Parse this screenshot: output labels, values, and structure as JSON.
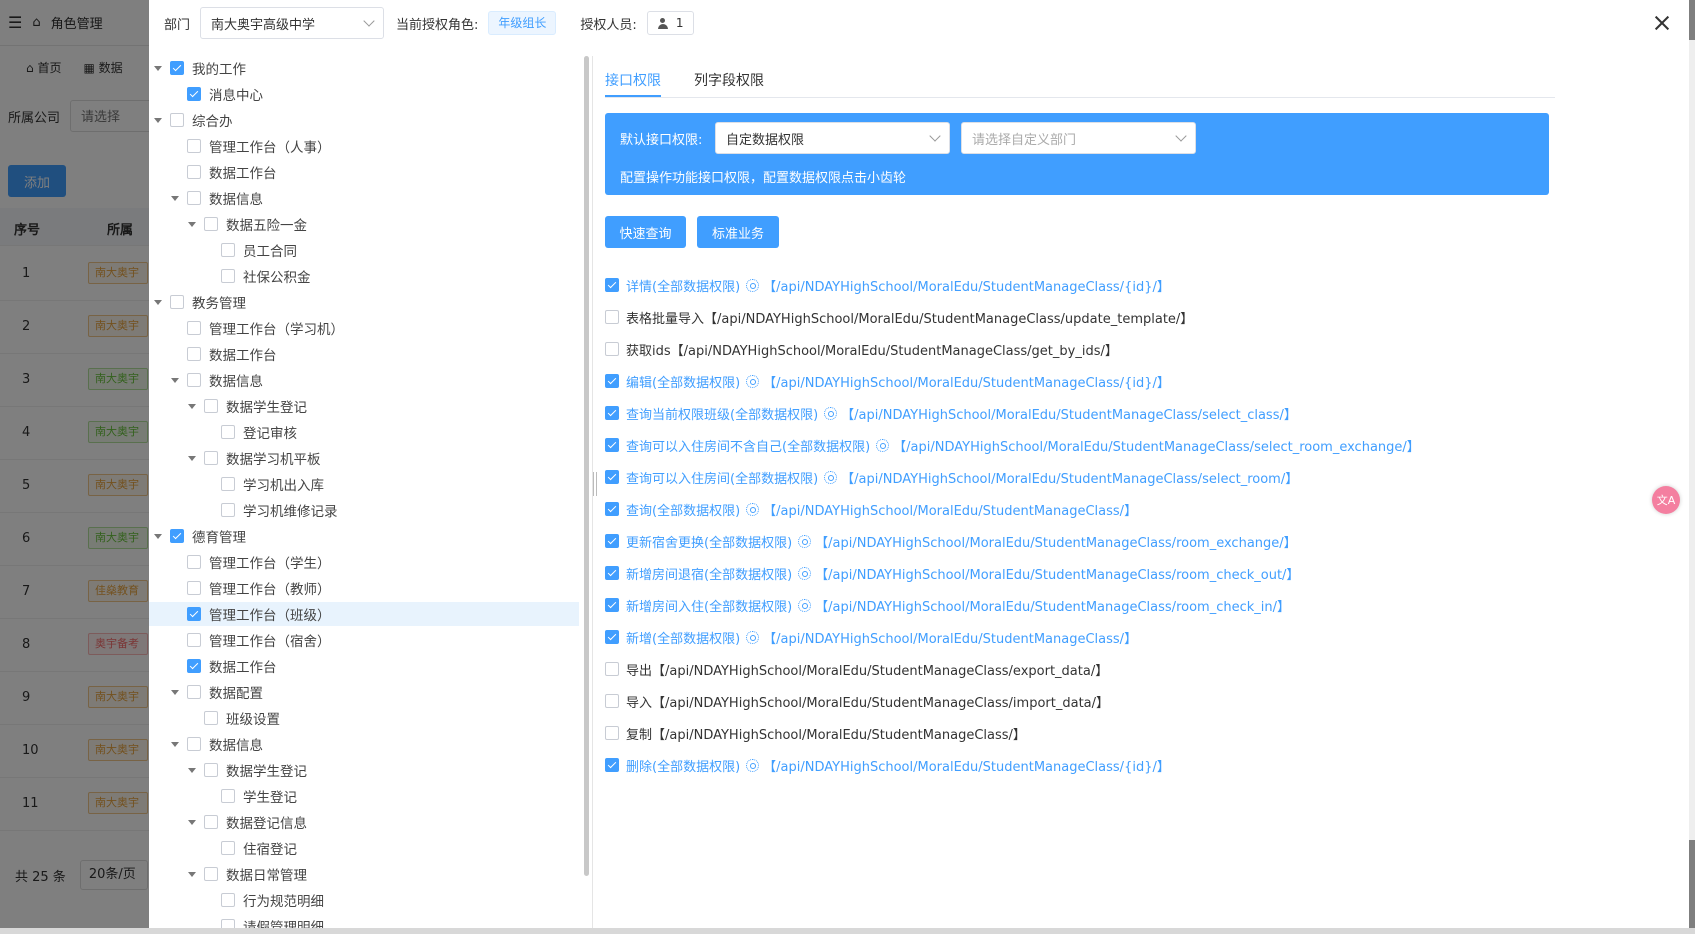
{
  "background": {
    "menu_icon": "menu-icon",
    "home_icon": "home-icon",
    "title": "角色管理",
    "tabs": [
      "首页",
      "数据"
    ],
    "company_label": "所属公司",
    "company_placeholder": "请选择",
    "add_label": "添加",
    "col_index": "序号",
    "col_company": "所属",
    "rows": [
      {
        "num": "1",
        "tag": "南大奥宇"
      },
      {
        "num": "2",
        "tag": "南大奥宇"
      },
      {
        "num": "3",
        "tag": "南大奥宇"
      },
      {
        "num": "4",
        "tag": "南大奥宇"
      },
      {
        "num": "5",
        "tag": "南大奥宇"
      },
      {
        "num": "6",
        "tag": "南大奥宇"
      },
      {
        "num": "7",
        "tag": "佳燊教育"
      },
      {
        "num": "8",
        "tag": "奥宇备考"
      },
      {
        "num": "9",
        "tag": "南大奥宇"
      },
      {
        "num": "10",
        "tag": "南大奥宇"
      },
      {
        "num": "11",
        "tag": "南大奥宇"
      }
    ],
    "total": "共 25 条",
    "page_size": "20条/页"
  },
  "header": {
    "dept_label": "部门",
    "dept_value": "南大奥宇高级中学",
    "role_label": "当前授权角色:",
    "role_value": "年级组长",
    "person_label": "授权人员:",
    "person_count": "1"
  },
  "tree": [
    {
      "label": "我的工作",
      "level": 0,
      "caret": true,
      "checked": true
    },
    {
      "label": "消息中心",
      "level": 1,
      "caret": false,
      "checked": true
    },
    {
      "label": "综合办",
      "level": 0,
      "caret": true,
      "checked": false
    },
    {
      "label": "管理工作台（人事）",
      "level": 1,
      "caret": false,
      "checked": false
    },
    {
      "label": "数据工作台",
      "level": 1,
      "caret": false,
      "checked": false
    },
    {
      "label": "数据信息",
      "level": 1,
      "caret": true,
      "checked": false
    },
    {
      "label": "数据五险一金",
      "level": 2,
      "caret": true,
      "checked": false
    },
    {
      "label": "员工合同",
      "level": 3,
      "caret": false,
      "checked": false
    },
    {
      "label": "社保公积金",
      "level": 3,
      "caret": false,
      "checked": false
    },
    {
      "label": "教务管理",
      "level": 0,
      "caret": true,
      "checked": false
    },
    {
      "label": "管理工作台（学习机）",
      "level": 1,
      "caret": false,
      "checked": false
    },
    {
      "label": "数据工作台",
      "level": 1,
      "caret": false,
      "checked": false
    },
    {
      "label": "数据信息",
      "level": 1,
      "caret": true,
      "checked": false
    },
    {
      "label": "数据学生登记",
      "level": 2,
      "caret": true,
      "checked": false
    },
    {
      "label": "登记审核",
      "level": 3,
      "caret": false,
      "checked": false
    },
    {
      "label": "数据学习机平板",
      "level": 2,
      "caret": true,
      "checked": false
    },
    {
      "label": "学习机出入库",
      "level": 3,
      "caret": false,
      "checked": false
    },
    {
      "label": "学习机维修记录",
      "level": 3,
      "caret": false,
      "checked": false
    },
    {
      "label": "德育管理",
      "level": 0,
      "caret": true,
      "checked": true
    },
    {
      "label": "管理工作台（学生）",
      "level": 1,
      "caret": false,
      "checked": false
    },
    {
      "label": "管理工作台（教师）",
      "level": 1,
      "caret": false,
      "checked": false
    },
    {
      "label": "管理工作台（班级）",
      "level": 1,
      "caret": false,
      "checked": true,
      "highlight": true
    },
    {
      "label": "管理工作台（宿舍）",
      "level": 1,
      "caret": false,
      "checked": false
    },
    {
      "label": "数据工作台",
      "level": 1,
      "caret": false,
      "checked": true
    },
    {
      "label": "数据配置",
      "level": 1,
      "caret": true,
      "checked": false
    },
    {
      "label": "班级设置",
      "level": 2,
      "caret": false,
      "checked": false
    },
    {
      "label": "数据信息",
      "level": 1,
      "caret": true,
      "checked": false
    },
    {
      "label": "数据学生登记",
      "level": 2,
      "caret": true,
      "checked": false
    },
    {
      "label": "学生登记",
      "level": 3,
      "caret": false,
      "checked": false
    },
    {
      "label": "数据登记信息",
      "level": 2,
      "caret": true,
      "checked": false
    },
    {
      "label": "住宿登记",
      "level": 3,
      "caret": false,
      "checked": false
    },
    {
      "label": "数据日常管理",
      "level": 2,
      "caret": true,
      "checked": false
    },
    {
      "label": "行为规范明细",
      "level": 3,
      "caret": false,
      "checked": false
    },
    {
      "label": "请假管理明细",
      "level": 3,
      "caret": false,
      "checked": false
    }
  ],
  "panel": {
    "tab_api": "接口权限",
    "tab_field": "列字段权限",
    "default_label": "默认接口权限:",
    "default_value": "自定数据权限",
    "dept_placeholder": "请选择自定义部门",
    "hint": "配置操作功能接口权限，配置数据权限点击小齿轮",
    "btn_quick": "快速查询",
    "btn_standard": "标准业务"
  },
  "apis": [
    {
      "label": "详情(全部数据权限)",
      "path": "【/api/NDAYHighSchool/MoralEdu/StudentManageClass/{id}/】",
      "checked": true
    },
    {
      "label": "表格批量导入",
      "path": "【/api/NDAYHighSchool/MoralEdu/StudentManageClass/update_template/】",
      "checked": false
    },
    {
      "label": "获取ids",
      "path": "【/api/NDAYHighSchool/MoralEdu/StudentManageClass/get_by_ids/】",
      "checked": false
    },
    {
      "label": "编辑(全部数据权限)",
      "path": "【/api/NDAYHighSchool/MoralEdu/StudentManageClass/{id}/】",
      "checked": true
    },
    {
      "label": "查询当前权限班级(全部数据权限)",
      "path": "【/api/NDAYHighSchool/MoralEdu/StudentManageClass/select_class/】",
      "checked": true
    },
    {
      "label": "查询可以入住房间不含自己(全部数据权限)",
      "path": "【/api/NDAYHighSchool/MoralEdu/StudentManageClass/select_room_exchange/】",
      "checked": true
    },
    {
      "label": "查询可以入住房间(全部数据权限)",
      "path": "【/api/NDAYHighSchool/MoralEdu/StudentManageClass/select_room/】",
      "checked": true
    },
    {
      "label": "查询(全部数据权限)",
      "path": "【/api/NDAYHighSchool/MoralEdu/StudentManageClass/】",
      "checked": true
    },
    {
      "label": "更新宿舍更换(全部数据权限)",
      "path": "【/api/NDAYHighSchool/MoralEdu/StudentManageClass/room_exchange/】",
      "checked": true
    },
    {
      "label": "新增房间退宿(全部数据权限)",
      "path": "【/api/NDAYHighSchool/MoralEdu/StudentManageClass/room_check_out/】",
      "checked": true
    },
    {
      "label": "新增房间入住(全部数据权限)",
      "path": "【/api/NDAYHighSchool/MoralEdu/StudentManageClass/room_check_in/】",
      "checked": true
    },
    {
      "label": "新增(全部数据权限)",
      "path": "【/api/NDAYHighSchool/MoralEdu/StudentManageClass/】",
      "checked": true
    },
    {
      "label": "导出",
      "path": "【/api/NDAYHighSchool/MoralEdu/StudentManageClass/export_data/】",
      "checked": false
    },
    {
      "label": "导入",
      "path": "【/api/NDAYHighSchool/MoralEdu/StudentManageClass/import_data/】",
      "checked": false
    },
    {
      "label": "复制",
      "path": "【/api/NDAYHighSchool/MoralEdu/StudentManageClass/】",
      "checked": false
    },
    {
      "label": "删除(全部数据权限)",
      "path": "【/api/NDAYHighSchool/MoralEdu/StudentManageClass/{id}/】",
      "checked": true
    }
  ],
  "floating": {
    "translate_label": "文A"
  },
  "colors": {
    "accent": "#409eff",
    "highlight": "#e8f3fd"
  }
}
